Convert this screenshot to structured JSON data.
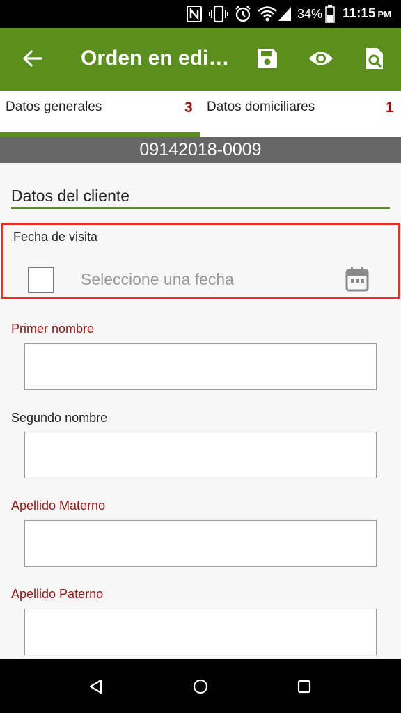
{
  "status_bar": {
    "nfc_icon": "nfc-icon",
    "vibrate_icon": "vibrate-icon",
    "alarm_icon": "alarm-icon",
    "wifi_icon": "wifi-icon",
    "signal_icon": "signal-icon",
    "battery_percent": "34%",
    "battery_icon": "battery-icon",
    "time": "11:15",
    "ampm": "PM"
  },
  "app_bar": {
    "back_icon": "arrow-left-icon",
    "title": "Orden en edi…",
    "save_icon": "save-icon",
    "view_icon": "eye-icon",
    "search_doc_icon": "document-search-icon",
    "background": "#5a8f1d"
  },
  "tabs": [
    {
      "label": "Datos generales",
      "count": "3",
      "selected": true
    },
    {
      "label": "Datos domiciliares",
      "count": "1",
      "selected": false
    }
  ],
  "order_number": "09142018-0009",
  "section_title": "Datos del cliente",
  "date_field": {
    "label": "Fecha de visita",
    "placeholder": "Seleccione una fecha",
    "checked": false,
    "calendar_icon": "calendar-icon",
    "highlight_color": "#e53320"
  },
  "fields": [
    {
      "label": "Primer nombre",
      "value": "",
      "required": true
    },
    {
      "label": "Segundo nombre",
      "value": "",
      "required": false
    },
    {
      "label": "Apellido Materno",
      "value": "",
      "required": true
    },
    {
      "label": "Apellido Paterno",
      "value": "",
      "required": true
    }
  ],
  "nav_bar": {
    "back_icon": "triangle-back-icon",
    "home_icon": "circle-home-icon",
    "recents_icon": "square-recents-icon"
  }
}
